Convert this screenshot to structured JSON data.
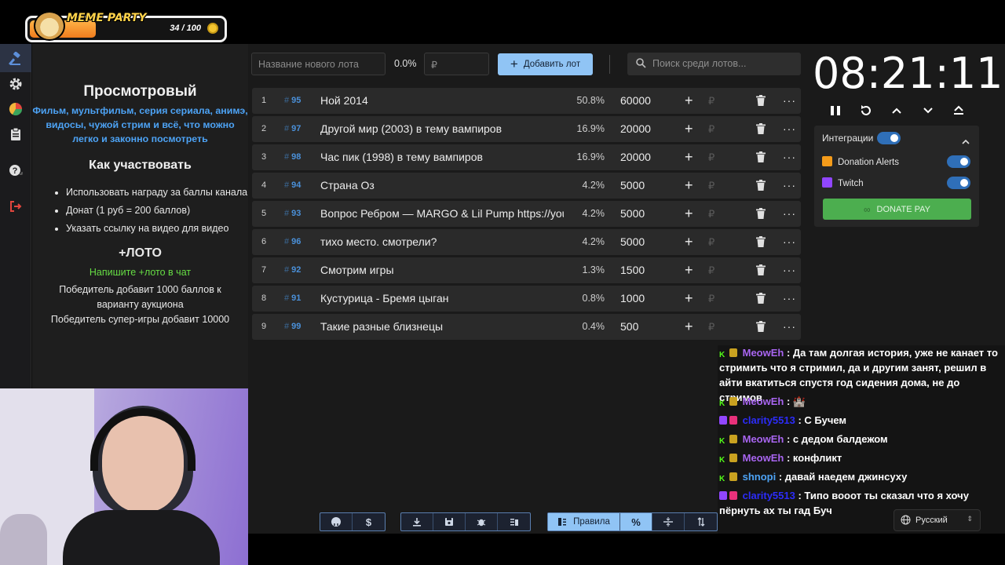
{
  "overlay": {
    "title": "MEME PARTY",
    "progress_text": "34 / 100",
    "progress_fraction": 0.34
  },
  "sidebar": {
    "items": [
      {
        "icon": "gavel-icon",
        "active": true
      },
      {
        "icon": "gear-icon"
      },
      {
        "icon": "pie-chart-icon"
      },
      {
        "icon": "clipboard-icon"
      },
      {
        "icon": "help-icon"
      },
      {
        "icon": "logout-icon"
      }
    ]
  },
  "rules": {
    "title": "Просмотровый",
    "subtitle": "Фильм, мультфильм, серия сериала, анимэ, видосы, чужой стрим и всё, что можно легко и законно посмотреть",
    "how_title": "Как участвовать",
    "how_items": [
      "Использовать награду за баллы канала",
      "Донат (1 руб = 200 баллов)",
      "Указать ссылку на видео для видео"
    ],
    "loto_title": "+ЛОТО",
    "loto_hint": "Напишите +лото в чат",
    "loto_text1": "Победитель добавит 1000 баллов к варианту аукциона",
    "loto_text2": "Победитель супер-игры добавит 10000"
  },
  "new_lot": {
    "name_placeholder": "Название нового лота",
    "percent": "0.0%",
    "amount_placeholder": "₽",
    "add_label": "Добавить лот"
  },
  "search": {
    "placeholder": "Поиск среди лотов..."
  },
  "lots": [
    {
      "index": "1",
      "id": "95",
      "name": "Ной 2014",
      "percent": "50.8%",
      "amount": "60000"
    },
    {
      "index": "2",
      "id": "97",
      "name": "Другой мир (2003) в тему вампиров",
      "percent": "16.9%",
      "amount": "20000"
    },
    {
      "index": "3",
      "id": "98",
      "name": "Час пик (1998) в тему вампиров",
      "percent": "16.9%",
      "amount": "20000"
    },
    {
      "index": "4",
      "id": "94",
      "name": "Страна Оз",
      "percent": "4.2%",
      "amount": "5000"
    },
    {
      "index": "5",
      "id": "93",
      "name": "Вопрос Ребром — MARGO & Lil Pump https://youtu",
      "percent": "4.2%",
      "amount": "5000"
    },
    {
      "index": "6",
      "id": "96",
      "name": "тихо место. смотрели?",
      "percent": "4.2%",
      "amount": "5000"
    },
    {
      "index": "7",
      "id": "92",
      "name": "Смотрим игры",
      "percent": "1.3%",
      "amount": "1500"
    },
    {
      "index": "8",
      "id": "91",
      "name": "Кустурица - Бремя цыган",
      "percent": "0.8%",
      "amount": "1000"
    },
    {
      "index": "9",
      "id": "99",
      "name": "Такие разные близнецы",
      "percent": "0.4%",
      "amount": "500"
    }
  ],
  "lot_row": {
    "plus": "+",
    "currency": "₽",
    "more": "···",
    "hash": "#"
  },
  "timer": {
    "value": "08:21:11"
  },
  "integrations": {
    "title": "Интеграции",
    "services": [
      {
        "name": "Donation Alerts",
        "enabled": true
      },
      {
        "name": "Twitch",
        "enabled": true
      }
    ],
    "donatepay_label": "DONATE PAY"
  },
  "chat": {
    "messages": [
      {
        "badges": [
          "kick",
          "crown"
        ],
        "user": "MeowEh",
        "text": ": Да там долгая история, уже не канает то стримить что я стримил, да и другим занят, решил в айти вкатиться спустя год сидения дома, не до стримов"
      },
      {
        "badges": [
          "kick",
          "crown"
        ],
        "user": "MeowEh",
        "text": ": 🏰"
      },
      {
        "badges": [
          "twitch",
          "pink"
        ],
        "user": "clarity5513",
        "text": ": С Бучем"
      },
      {
        "badges": [
          "kick",
          "crown"
        ],
        "user": "MeowEh",
        "text": ": с дедом балдежом"
      },
      {
        "badges": [
          "kick",
          "crown"
        ],
        "user": "MeowEh",
        "text": ": конфликт"
      },
      {
        "badges": [
          "kick",
          "crown"
        ],
        "user": "shnopi",
        "text": ": давай наедем джинсуху"
      },
      {
        "badges": [
          "twitch",
          "pink"
        ],
        "user": "clarity5513",
        "text": ": Типо вооот ты сказал что я хочу пёрнуть ах ты гад Буч"
      }
    ]
  },
  "language": {
    "selected": "Русский"
  },
  "toolbar": {
    "rules_label": "Правила",
    "percent_label": "%"
  },
  "colors": {
    "accent": "#90c4f5",
    "lot_id": "#4a90d9",
    "donate": "#4cae4f",
    "green_text": "#66dd44",
    "rules_blue": "#4da3f5"
  }
}
